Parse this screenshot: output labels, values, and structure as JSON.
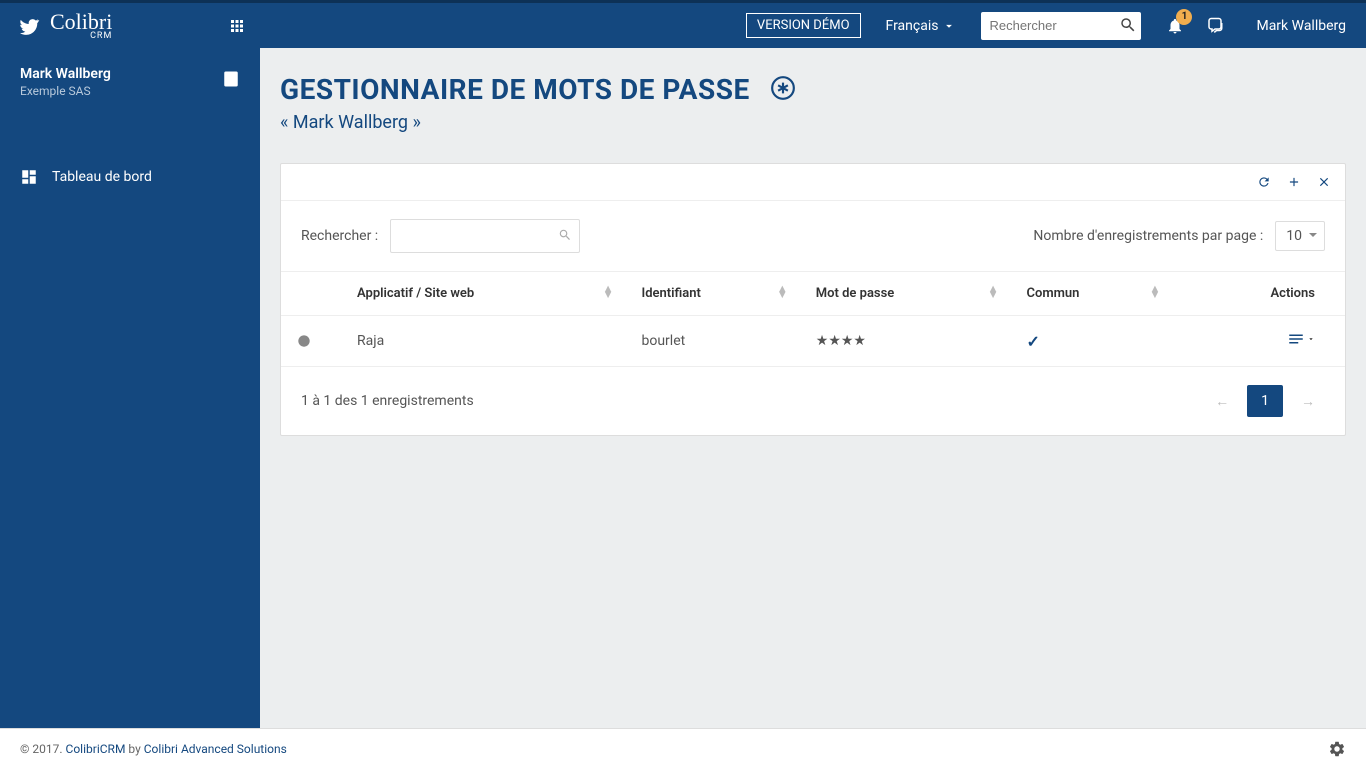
{
  "header": {
    "brand_name": "Colibri",
    "brand_sub": "CRM",
    "demo_badge": "VERSION DÉMO",
    "language": "Français",
    "search_placeholder": "Rechercher",
    "notification_count": "1",
    "user_display": "Mark Wallberg"
  },
  "sidebar": {
    "user_name": "Mark Wallberg",
    "company": "Exemple SAS",
    "items": [
      {
        "label": "Tableau de bord"
      }
    ]
  },
  "page": {
    "title": "GESTIONNAIRE DE MOTS DE PASSE",
    "subtitle": "« Mark Wallberg »"
  },
  "toolbar": {
    "search_label": "Rechercher :",
    "page_size_label": "Nombre d'enregistrements par page :",
    "page_size_value": "10"
  },
  "table": {
    "columns": {
      "app": "Applicatif / Site web",
      "identifier": "Identifiant",
      "password": "Mot de passe",
      "common": "Commun",
      "actions": "Actions"
    },
    "rows": [
      {
        "app": "Raja",
        "identifier": "bourlet",
        "password": "★★★★",
        "common": true
      }
    ]
  },
  "pagination": {
    "info": "1 à 1 des 1 enregistrements",
    "prev": "←",
    "current": "1",
    "next": "→"
  },
  "footer": {
    "copyright": "© 2017. ",
    "link1": "ColibriCRM",
    "by": " by ",
    "link2": "Colibri Advanced Solutions"
  }
}
